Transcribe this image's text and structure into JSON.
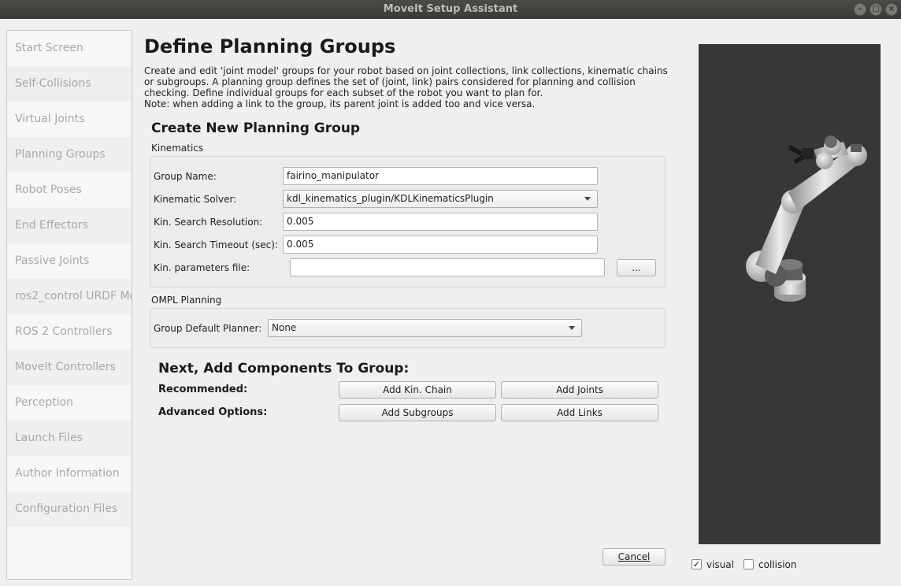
{
  "window": {
    "title": "MoveIt Setup Assistant"
  },
  "sidebar": {
    "items": [
      {
        "label": "Start Screen"
      },
      {
        "label": "Self-Collisions"
      },
      {
        "label": "Virtual Joints"
      },
      {
        "label": "Planning Groups"
      },
      {
        "label": "Robot Poses"
      },
      {
        "label": "End Effectors"
      },
      {
        "label": "Passive Joints"
      },
      {
        "label": "ros2_control URDF Mo"
      },
      {
        "label": "ROS 2 Controllers"
      },
      {
        "label": "MoveIt Controllers"
      },
      {
        "label": "Perception"
      },
      {
        "label": "Launch Files"
      },
      {
        "label": "Author Information"
      },
      {
        "label": "Configuration Files"
      }
    ]
  },
  "page": {
    "title": "Define Planning Groups",
    "description": [
      "Create and edit 'joint model' groups for your robot based on joint collections, link collections, kinematic chains",
      "or subgroups. A planning group defines the set of (joint, link) pairs considered for planning and collision",
      "checking. Define individual groups for each subset of the robot you want to plan for.",
      "Note: when adding a link to the group, its parent joint is added too and vice versa."
    ]
  },
  "create_group": {
    "heading": "Create New Planning Group",
    "kinematics_label": "Kinematics",
    "group_name": {
      "label": "Group Name:",
      "value": "fairino_manipulator"
    },
    "kinematic_solver": {
      "label": "Kinematic Solver:",
      "value": "kdl_kinematics_plugin/KDLKinematicsPlugin"
    },
    "search_resolution": {
      "label": "Kin. Search Resolution:",
      "value": "0.005"
    },
    "search_timeout": {
      "label": "Kin. Search Timeout (sec):",
      "value": "0.005"
    },
    "params_file": {
      "label": "Kin. parameters file:",
      "value": "",
      "browse_label": "..."
    },
    "ompl_label": "OMPL Planning",
    "default_planner": {
      "label": "Group Default Planner:",
      "value": "None"
    }
  },
  "components": {
    "heading": "Next, Add Components To Group:",
    "recommended_label": "Recommended:",
    "advanced_label": "Advanced Options:",
    "add_kin_chain": "Add Kin. Chain",
    "add_joints": "Add Joints",
    "add_subgroups": "Add Subgroups",
    "add_links": "Add Links"
  },
  "footer": {
    "cancel_label": "Cancel"
  },
  "viewer": {
    "visual_label": "visual",
    "visual_checked": true,
    "collision_label": "collision",
    "collision_checked": false
  }
}
